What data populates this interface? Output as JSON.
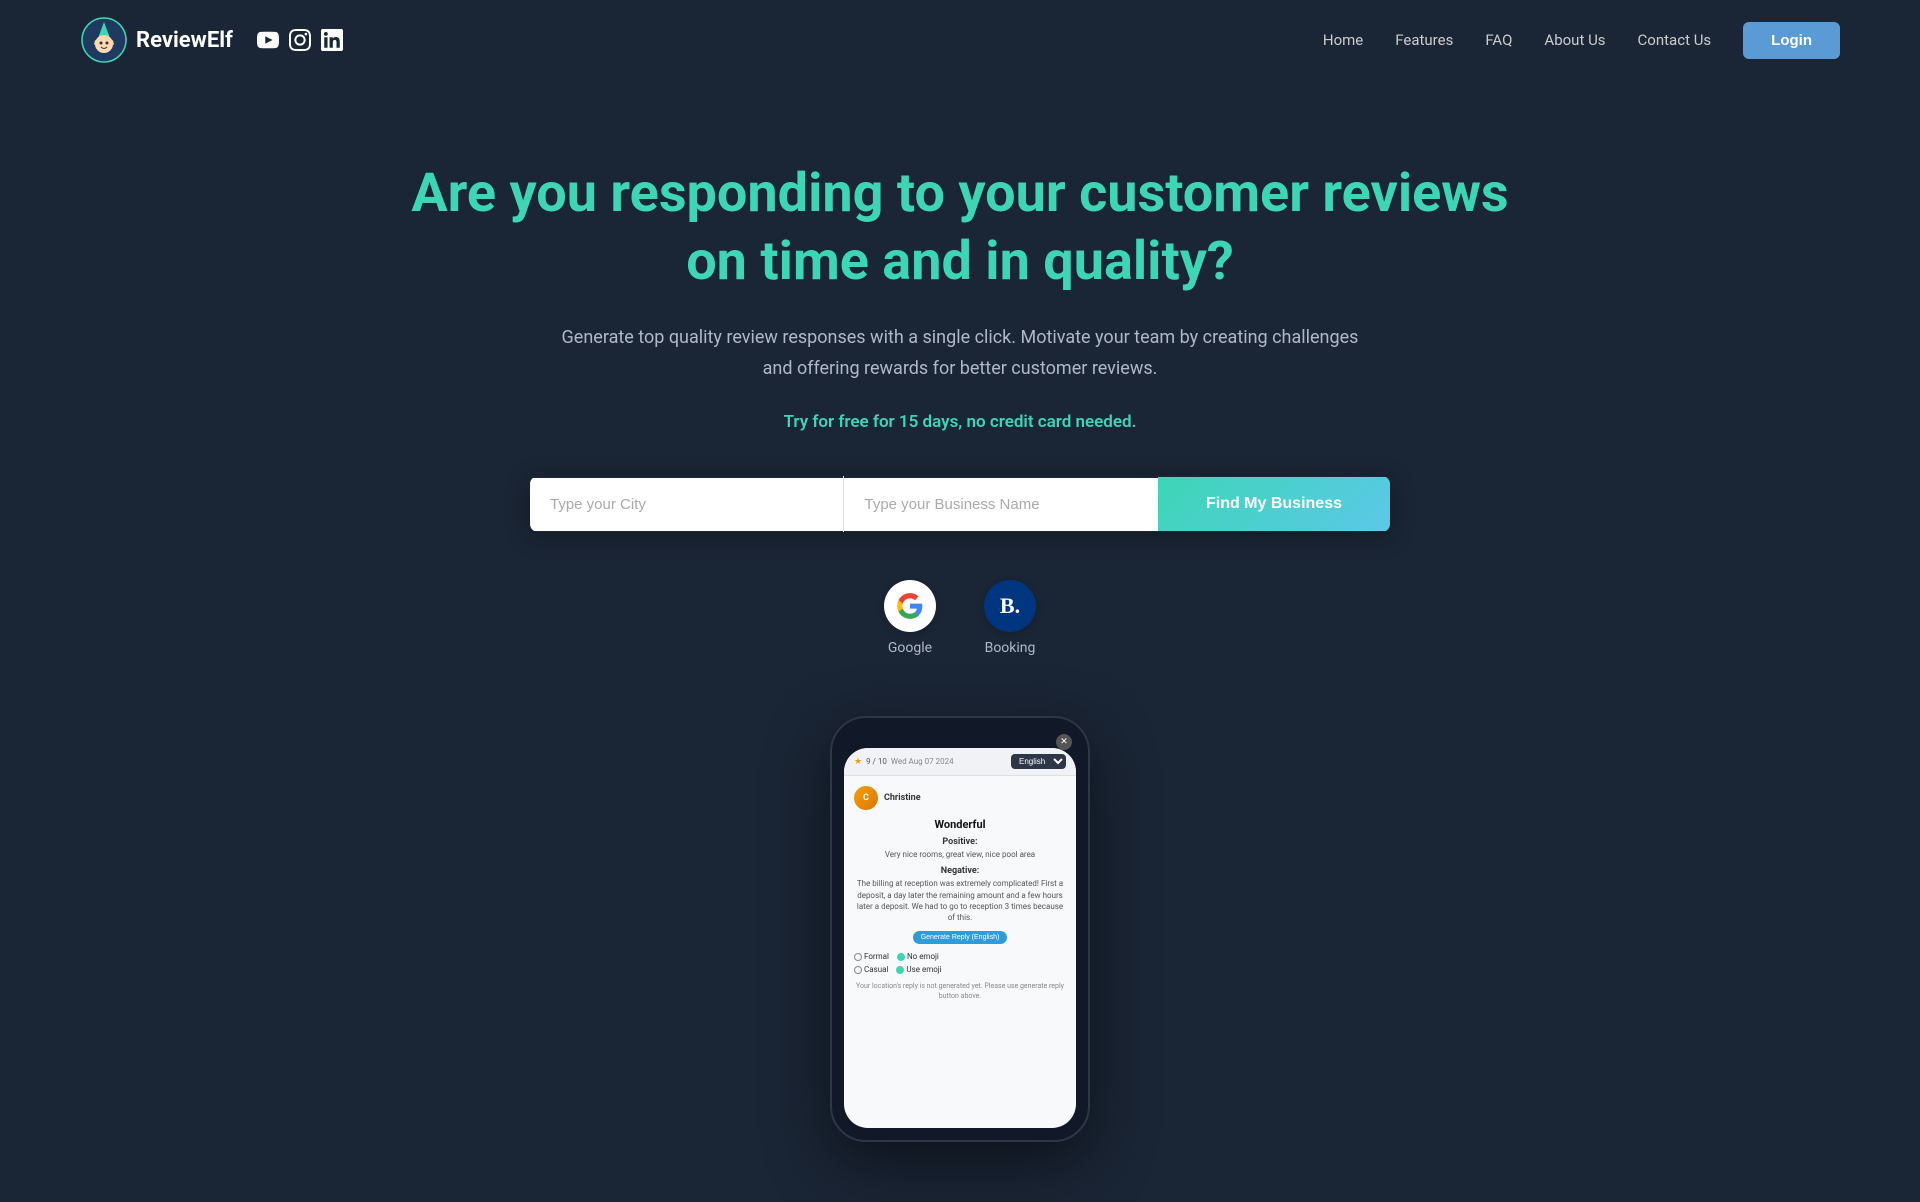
{
  "brand": {
    "name": "ReviewElf",
    "logo_alt": "ReviewElf logo"
  },
  "social": {
    "youtube_label": "YouTube",
    "instagram_label": "Instagram",
    "linkedin_label": "LinkedIn"
  },
  "nav": {
    "home": "Home",
    "features": "Features",
    "faq": "FAQ",
    "about_us": "About Us",
    "contact_us": "Contact Us",
    "login": "Login"
  },
  "hero": {
    "title": "Are you responding to your customer reviews on time and in quality?",
    "subtitle": "Generate top quality review responses with a single click. Motivate your team by creating challenges and offering rewards for better customer reviews.",
    "cta": "Try for free for 15 days, no credit card needed.",
    "city_placeholder": "Type your City",
    "business_placeholder": "Type your Business Name",
    "find_btn": "Find My Business"
  },
  "platforms": [
    {
      "name": "Google",
      "label": "Google"
    },
    {
      "name": "Booking",
      "label": "Booking"
    }
  ],
  "phone": {
    "date": "Wed Aug 07 2024",
    "score": "9 / 10",
    "reviewer": "Christine",
    "language": "English",
    "review_title": "Wonderful",
    "positive_label": "Positive:",
    "positive_text": "Very nice rooms, great view, nice pool area",
    "negative_label": "Negative:",
    "negative_text": "The billing at reception was extremely complicated! First a deposit, a day later the remaining amount and a few hours later a deposit. We had to go to reception 3 times because of this.",
    "generate_btn": "Generate Reply (English)",
    "formal_label": "Formal",
    "no_emoji_label": "No emoji",
    "casual_label": "Casual",
    "use_emoji_label": "Use emoji",
    "footer_msg": "Your location's reply is not generated yet. Please use generate reply button above."
  }
}
